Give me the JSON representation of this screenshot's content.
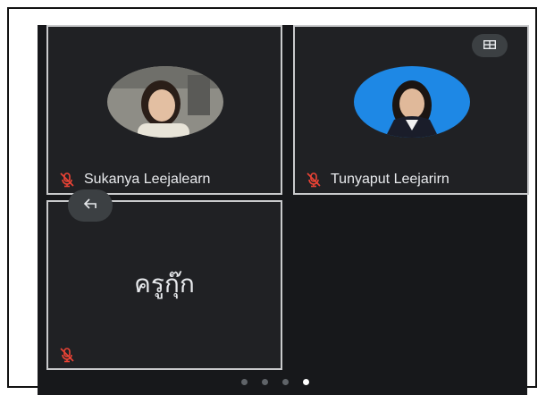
{
  "participants": [
    {
      "name": "Sukanya Leejalearn",
      "mic": "mic-off-icon"
    },
    {
      "name": "Tunyaput Leejarirn",
      "mic": "mic-off-icon"
    },
    {
      "name": "ครูกุ๊ก",
      "mic": "mic-off-icon"
    }
  ],
  "controls": {
    "layout_icon": "layout-grid-icon",
    "back_icon": "back-arrow-icon"
  },
  "pager": {
    "pages": 4,
    "current_page": 4
  },
  "colors": {
    "background": "#17181b",
    "tile": "#202124",
    "tile_border": "#c9cacc",
    "mic_off": "#ea4335",
    "avatar2_bg": "#1e88e5"
  }
}
